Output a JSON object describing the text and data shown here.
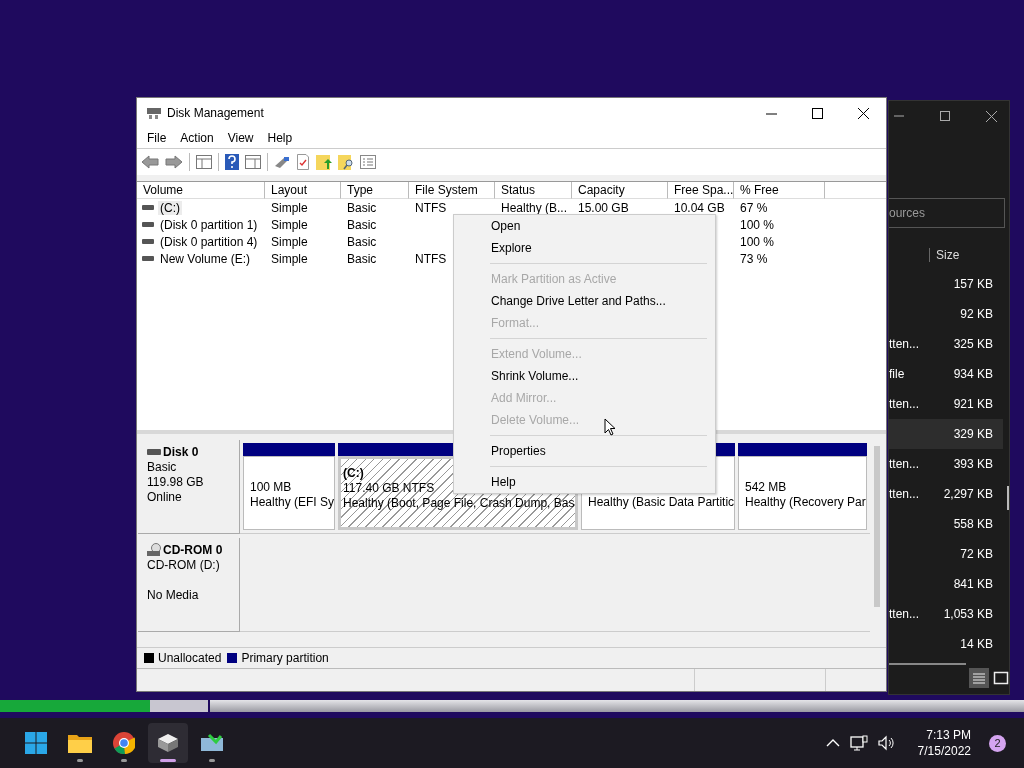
{
  "desktop": {
    "progress": {
      "level": 0.72
    }
  },
  "background_window": {
    "search": {
      "placeholder": "ources"
    },
    "columns": [
      "Size"
    ],
    "rows": [
      {
        "size": "157 KB",
        "selected": false
      },
      {
        "size": "92 KB",
        "selected": false
      },
      {
        "name": "tten...",
        "size": "325 KB",
        "selected": false
      },
      {
        "name": "file",
        "size": "934 KB",
        "selected": false
      },
      {
        "name": "tten...",
        "size": "921 KB",
        "selected": false
      },
      {
        "size": "329 KB",
        "selected": true
      },
      {
        "name": "tten...",
        "size": "393 KB",
        "selected": false
      },
      {
        "name": "tten...",
        "size": "2,297 KB",
        "selected": false
      },
      {
        "size": "558 KB",
        "selected": false
      },
      {
        "size": "72 KB",
        "selected": false
      },
      {
        "size": "841 KB",
        "selected": false
      },
      {
        "name": "tten...",
        "size": "1,053 KB",
        "selected": false
      },
      {
        "size": "14 KB",
        "selected": false
      }
    ]
  },
  "window": {
    "title": "Disk Management"
  },
  "menu_bar": [
    "File",
    "Action",
    "View",
    "Help"
  ],
  "volume_table": {
    "columns": [
      "Volume",
      "Layout",
      "Type",
      "File System",
      "Status",
      "Capacity",
      "Free Spa...",
      "% Free"
    ],
    "rows": [
      {
        "volume": "(C:)",
        "layout": "Simple",
        "type": "Basic",
        "file_system": "NTFS",
        "status": "Healthy (B...",
        "capacity": "15.00 GB",
        "free_space": "10.04 GB",
        "pct_free": "67 %",
        "selected": true
      },
      {
        "volume": "(Disk 0 partition 1)",
        "layout": "Simple",
        "type": "Basic",
        "pct_free": "100 %",
        "selected": false
      },
      {
        "volume": "(Disk 0 partition 4)",
        "layout": "Simple",
        "type": "Basic",
        "pct_free": "100 %",
        "selected": false
      },
      {
        "volume": "New Volume (E:)",
        "layout": "Simple",
        "type": "Basic",
        "file_system": "NTFS",
        "pct_free": "73 %",
        "selected": false
      }
    ]
  },
  "disks": [
    {
      "kind": "disk",
      "name": "Disk 0",
      "type": "Basic",
      "size": "119.98 GB",
      "status": "Online",
      "partitions": [
        {
          "kind": "primary",
          "size": "100 MB",
          "status": "Healthy (EFI Sy",
          "selected": false
        },
        {
          "kind": "primary",
          "label": "(C:)",
          "size": "117.40 GB NTFS",
          "status": "Healthy (Boot, Page File, Crash Dump, Bas",
          "selected": true
        },
        {
          "kind": "primary",
          "status": "Healthy (Basic Data Partitic",
          "selected": false
        },
        {
          "kind": "primary",
          "size": "542 MB",
          "status": "Healthy (Recovery Par",
          "selected": false
        }
      ]
    },
    {
      "kind": "cdrom",
      "name": "CD-ROM 0",
      "type": "CD-ROM (D:)",
      "status": "No Media"
    }
  ],
  "legend": [
    {
      "label": "Unallocated",
      "color": "#000000"
    },
    {
      "label": "Primary partition",
      "color": "#000080"
    }
  ],
  "context_menu": [
    {
      "kind": "item",
      "label": "Open",
      "disabled": false
    },
    {
      "kind": "item",
      "label": "Explore",
      "disabled": false
    },
    {
      "kind": "separator"
    },
    {
      "kind": "item",
      "label": "Mark Partition as Active",
      "disabled": true
    },
    {
      "kind": "item",
      "label": "Change Drive Letter and Paths...",
      "disabled": false
    },
    {
      "kind": "item",
      "label": "Format...",
      "disabled": true
    },
    {
      "kind": "separator"
    },
    {
      "kind": "item",
      "label": "Extend Volume...",
      "disabled": true
    },
    {
      "kind": "item",
      "label": "Shrink Volume...",
      "disabled": false
    },
    {
      "kind": "item",
      "label": "Add Mirror...",
      "disabled": true
    },
    {
      "kind": "item",
      "label": "Delete Volume...",
      "disabled": true
    },
    {
      "kind": "separator"
    },
    {
      "kind": "item",
      "label": "Properties",
      "disabled": false
    },
    {
      "kind": "separator"
    },
    {
      "kind": "item",
      "label": "Help",
      "disabled": false
    }
  ],
  "taskbar": {
    "apps": [
      {
        "kind": "start",
        "selected": false
      },
      {
        "kind": "folder",
        "selected": false
      },
      {
        "kind": "browser",
        "selected": false
      },
      {
        "kind": "disk",
        "selected": true
      },
      {
        "kind": "tool",
        "selected": false
      }
    ],
    "time": "7:13 PM",
    "date": "7/15/2022",
    "badge": "2"
  }
}
